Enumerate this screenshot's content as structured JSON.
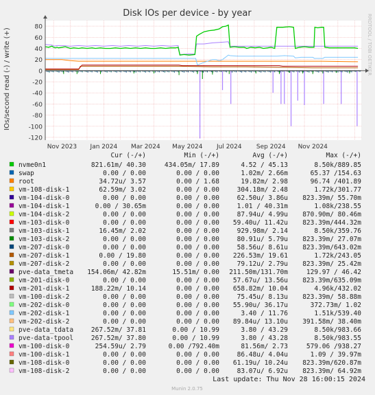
{
  "chart_data": {
    "type": "line",
    "title": "Disk IOs per device - by year",
    "ylabel": "IOs/second read (-) / write (+)",
    "watermark": "RRDTOOL / TOBI OETIKER",
    "ylim": [
      -125,
      90
    ],
    "y_ticks": [
      "80",
      "60",
      "40",
      "20",
      "0",
      "-20",
      "-40",
      "-60",
      "-80",
      "-100",
      "-120"
    ],
    "x_ticks": [
      "Nov 2023",
      "Jan 2024",
      "Mar 2024",
      "May 2024",
      "Jul 2024",
      "Sep 2024",
      "Nov 2024"
    ],
    "grid": true,
    "column_headers": [
      "Cur (-/+)",
      "Min (-/+)",
      "Avg (-/+)",
      "Max (-/+)"
    ],
    "series": [
      {
        "name": "nvme0n1",
        "color": "#00cc00",
        "cur": "821.61m/ 40.30",
        "min": "434.05m/ 17.89",
        "avg": "4.52 / 45.13",
        "max": "8.50k/889.85"
      },
      {
        "name": "swap",
        "color": "#0066b3",
        "cur": "0.00 / 0.00",
        "min": "0.00 / 0.00",
        "avg": "1.02m/ 2.66m",
        "max": "65.37 /154.63"
      },
      {
        "name": "root",
        "color": "#ff8000",
        "cur": "34.72u/ 3.57",
        "min": "0.00 / 1.68",
        "avg": "19.82m/ 2.98",
        "max": "96.74 /401.89"
      },
      {
        "name": "vm-108-disk-1",
        "color": "#ffcc00",
        "cur": "62.59m/ 3.02",
        "min": "0.00 / 0.00",
        "avg": "304.18m/ 2.48",
        "max": "1.72k/301.77"
      },
      {
        "name": "vm-104-disk-0",
        "color": "#330099",
        "cur": "0.00 / 0.00",
        "min": "0.00 / 0.00",
        "avg": "62.50u/ 3.86u",
        "max": "823.39m/ 55.70m"
      },
      {
        "name": "vm-104-disk-1",
        "color": "#990099",
        "cur": "0.00 / 30.65m",
        "min": "0.00 / 0.00",
        "avg": "1.01 / 40.31m",
        "max": "1.08k/238.55"
      },
      {
        "name": "vm-104-disk-2",
        "color": "#ccff00",
        "cur": "0.00 / 0.00",
        "min": "0.00 / 0.00",
        "avg": "87.94u/ 4.99u",
        "max": "870.90m/ 80.46m"
      },
      {
        "name": "vm-103-disk-0",
        "color": "#ff0000",
        "cur": "0.00 / 0.00",
        "min": "0.00 / 0.00",
        "avg": "59.40u/ 11.42u",
        "max": "823.39m/444.32m"
      },
      {
        "name": "vm-103-disk-1",
        "color": "#808080",
        "cur": "16.45m/ 2.02",
        "min": "0.00 / 0.00",
        "avg": "929.98m/ 2.14",
        "max": "8.50k/359.76"
      },
      {
        "name": "vm-103-disk-2",
        "color": "#008f00",
        "cur": "0.00 / 0.00",
        "min": "0.00 / 0.00",
        "avg": "80.91u/ 5.79u",
        "max": "823.39m/ 27.07m"
      },
      {
        "name": "vm-207-disk-0",
        "color": "#00487d",
        "cur": "0.00 / 0.00",
        "min": "0.00 / 0.00",
        "avg": "58.56u/ 8.61u",
        "max": "823.39m/643.02m"
      },
      {
        "name": "vm-207-disk-1",
        "color": "#b35a00",
        "cur": "0.00 / 19.80",
        "min": "0.00 / 0.00",
        "avg": "226.53m/ 19.61",
        "max": "1.72k/243.05"
      },
      {
        "name": "vm-207-disk-2",
        "color": "#b38f00",
        "cur": "0.00 / 0.00",
        "min": "0.00 / 0.00",
        "avg": "79.12u/ 2.79u",
        "max": "823.39m/ 25.42m"
      },
      {
        "name": "pve-data_tmeta",
        "color": "#6b006b",
        "cur": "154.06m/ 42.82m",
        "min": "15.51m/ 0.00",
        "avg": "211.50m/131.70m",
        "max": "129.97 / 46.42"
      },
      {
        "name": "vm-201-disk-0",
        "color": "#8fb300",
        "cur": "0.00 / 0.00",
        "min": "0.00 / 0.00",
        "avg": "57.67u/ 13.56u",
        "max": "823.39m/635.09m"
      },
      {
        "name": "vm-201-disk-1",
        "color": "#b30000",
        "cur": "188.22m/ 10.14",
        "min": "0.00 / 0.00",
        "avg": "658.82m/ 10.04",
        "max": "4.96k/432.02"
      },
      {
        "name": "vm-100-disk-2",
        "color": "#bebebe",
        "cur": "0.00 / 0.00",
        "min": "0.00 / 0.00",
        "avg": "75.45u/ 8.13u",
        "max": "823.39m/ 58.88m"
      },
      {
        "name": "vm-202-disk-0",
        "color": "#80ff80",
        "cur": "0.00 / 0.00",
        "min": "0.00 / 0.00",
        "avg": "55.90u/ 36.17u",
        "max": "372.73m/ 1.02"
      },
      {
        "name": "vm-202-disk-1",
        "color": "#80c9ff",
        "cur": "0.00 / 0.00",
        "min": "0.00 / 0.00",
        "avg": "3.40 / 11.76",
        "max": "1.51k/539.40"
      },
      {
        "name": "vm-202-disk-2",
        "color": "#ffc080",
        "cur": "0.00 / 0.00",
        "min": "0.00 / 0.00",
        "avg": "89.84u/ 13.10u",
        "max": "391.58m/ 38.40m"
      },
      {
        "name": "pve-data_tdata",
        "color": "#ffe680",
        "cur": "267.52m/ 37.81",
        "min": "0.00 / 10.99",
        "avg": "3.80 / 43.29",
        "max": "8.50k/983.66"
      },
      {
        "name": "pve-data-tpool",
        "color": "#aa80ff",
        "cur": "267.52m/ 37.80",
        "min": "0.00 / 10.99",
        "avg": "3.80 / 43.28",
        "max": "8.50k/983.55"
      },
      {
        "name": "vm-100-disk-0",
        "color": "#ee00cc",
        "cur": "254.59u/ 2.79",
        "min": "0.00 /792.40m",
        "avg": "81.56m/ 2.73",
        "max": "579.06 /938.27"
      },
      {
        "name": "vm-100-disk-1",
        "color": "#ff8080",
        "cur": "0.00 / 0.00",
        "min": "0.00 / 0.00",
        "avg": "86.48u/ 4.04u",
        "max": "1.09 / 39.97m"
      },
      {
        "name": "vm-108-disk-0",
        "color": "#666600",
        "cur": "0.00 / 0.00",
        "min": "0.00 / 0.00",
        "avg": "61.19u/ 10.24u",
        "max": "823.39m/620.87m"
      },
      {
        "name": "vm-108-disk-2",
        "color": "#ffbfff",
        "cur": "0.00 / 0.00",
        "min": "0.00 / 0.00",
        "avg": "83.07u/ 6.92u",
        "max": "823.39m/ 64.92m"
      }
    ],
    "lines": {
      "nvme_write": [
        [
          0,
          43
        ],
        [
          0.2,
          42
        ],
        [
          0.4,
          44
        ],
        [
          0.5,
          42
        ],
        [
          0.6,
          41
        ],
        [
          0.7,
          42
        ],
        [
          0.8,
          41
        ],
        [
          1.0,
          42
        ],
        [
          1.2,
          43
        ],
        [
          1.5,
          40
        ],
        [
          1.7,
          41
        ],
        [
          2.0,
          40
        ],
        [
          2.2,
          41
        ],
        [
          2.5,
          40
        ],
        [
          2.8,
          41
        ],
        [
          3.0,
          40
        ],
        [
          3.3,
          41
        ],
        [
          3.6,
          40
        ],
        [
          3.9,
          40
        ],
        [
          4.2,
          41
        ],
        [
          4.5,
          40
        ],
        [
          4.8,
          41
        ],
        [
          5.1,
          40
        ],
        [
          5.4,
          41
        ],
        [
          5.7,
          40
        ],
        [
          6.0,
          41
        ],
        [
          6.3,
          40
        ],
        [
          6.6,
          40
        ],
        [
          6.9,
          41
        ],
        [
          7.2,
          40
        ],
        [
          7.5,
          41
        ],
        [
          7.8,
          41
        ],
        [
          7.95,
          42
        ],
        [
          8.05,
          28
        ],
        [
          8.3,
          29
        ],
        [
          8.6,
          28
        ],
        [
          8.95,
          29
        ],
        [
          9.05,
          62
        ],
        [
          9.2,
          65
        ],
        [
          9.5,
          70
        ],
        [
          9.8,
          72
        ],
        [
          10.1,
          73
        ],
        [
          10.4,
          75
        ],
        [
          10.6,
          79
        ],
        [
          10.8,
          80
        ],
        [
          10.95,
          82
        ],
        [
          11.05,
          42
        ],
        [
          11.3,
          43
        ],
        [
          11.6,
          42
        ],
        [
          11.9,
          42
        ],
        [
          12.05,
          40
        ],
        [
          12.3,
          42
        ],
        [
          12.55,
          41
        ],
        [
          12.8,
          42
        ],
        [
          13.05,
          40
        ],
        [
          13.3,
          41
        ],
        [
          13.5,
          42
        ],
        [
          13.72,
          40
        ],
        [
          13.85,
          78
        ],
        [
          14.2,
          78
        ],
        [
          14.6,
          79
        ],
        [
          14.85,
          78
        ],
        [
          14.95,
          40
        ],
        [
          15.2,
          42
        ],
        [
          15.5,
          43
        ],
        [
          15.8,
          42
        ],
        [
          16.0,
          42
        ],
        [
          16.07,
          42
        ],
        [
          16.12,
          78
        ],
        [
          16.3,
          77
        ],
        [
          16.5,
          78
        ],
        [
          16.65,
          78
        ],
        [
          16.72,
          42
        ],
        [
          17.0,
          41
        ],
        [
          17.4,
          41
        ],
        [
          17.8,
          41
        ],
        [
          18.2,
          41
        ],
        [
          18.5,
          41
        ],
        [
          18.7,
          40
        ]
      ],
      "tpool_write": [
        [
          0,
          47
        ],
        [
          0.4,
          46
        ],
        [
          0.55,
          44
        ],
        [
          0.7,
          45
        ],
        [
          1.0,
          45
        ],
        [
          1.5,
          44
        ],
        [
          2.0,
          45
        ],
        [
          2.5,
          44
        ],
        [
          3.0,
          45
        ],
        [
          3.5,
          44
        ],
        [
          4.0,
          45
        ],
        [
          4.5,
          44
        ],
        [
          5.0,
          45
        ],
        [
          5.5,
          44
        ],
        [
          6.0,
          45
        ],
        [
          6.5,
          44
        ],
        [
          7.0,
          45
        ],
        [
          7.5,
          44
        ],
        [
          7.95,
          45
        ],
        [
          8.05,
          29
        ],
        [
          8.5,
          30
        ],
        [
          8.95,
          30
        ],
        [
          9.05,
          48
        ],
        [
          9.5,
          48
        ],
        [
          10.0,
          50
        ],
        [
          10.5,
          51
        ],
        [
          10.95,
          52
        ],
        [
          11.05,
          44
        ],
        [
          12.0,
          44
        ],
        [
          13.0,
          44
        ],
        [
          13.72,
          44
        ],
        [
          13.85,
          44
        ],
        [
          14.85,
          44
        ],
        [
          14.95,
          44
        ],
        [
          16.0,
          44
        ],
        [
          16.8,
          44
        ],
        [
          18.7,
          44
        ]
      ],
      "blue_write": [
        [
          0,
          22
        ],
        [
          7.95,
          22
        ],
        [
          8.05,
          22
        ],
        [
          9.0,
          22
        ],
        [
          9.1,
          10
        ],
        [
          9.5,
          15
        ],
        [
          9.8,
          18
        ],
        [
          10.0,
          20
        ],
        [
          10.2,
          20
        ],
        [
          10.4,
          18
        ],
        [
          10.6,
          20
        ],
        [
          10.95,
          28
        ],
        [
          11.05,
          27
        ],
        [
          11.5,
          26
        ],
        [
          12.0,
          26
        ],
        [
          13.72,
          26
        ],
        [
          13.85,
          26
        ],
        [
          14.3,
          27
        ],
        [
          14.85,
          26
        ],
        [
          14.95,
          23
        ],
        [
          15.3,
          24
        ],
        [
          15.8,
          24
        ],
        [
          16.0,
          24
        ],
        [
          16.1,
          22
        ],
        [
          16.6,
          22
        ],
        [
          16.72,
          24
        ],
        [
          17.2,
          24
        ],
        [
          18.0,
          24
        ],
        [
          18.7,
          24
        ]
      ],
      "root_write": [
        [
          0,
          20
        ],
        [
          1.0,
          20
        ],
        [
          1.5,
          18
        ],
        [
          2.0,
          17
        ],
        [
          4.0,
          17
        ],
        [
          7.0,
          17
        ],
        [
          9.0,
          17
        ],
        [
          11.0,
          17
        ],
        [
          13.0,
          17
        ],
        [
          15.0,
          17
        ],
        [
          16.5,
          17
        ],
        [
          18.7,
          16
        ]
      ],
      "vm201_write": [
        [
          0,
          3
        ],
        [
          2.0,
          3
        ],
        [
          2.2,
          10
        ],
        [
          4.0,
          10
        ],
        [
          6.0,
          10
        ],
        [
          8.0,
          10
        ],
        [
          8.2,
          9
        ],
        [
          10.0,
          9
        ],
        [
          12.0,
          9
        ],
        [
          14.0,
          9
        ],
        [
          14.2,
          8
        ],
        [
          16.0,
          8
        ],
        [
          18.0,
          8
        ],
        [
          18.7,
          8
        ]
      ],
      "vm207_write": [
        [
          0,
          2
        ],
        [
          2.0,
          2
        ],
        [
          2.1,
          8
        ],
        [
          4.0,
          8
        ],
        [
          8.0,
          8
        ],
        [
          10.0,
          7
        ],
        [
          12.0,
          7
        ],
        [
          14.0,
          6
        ],
        [
          16.0,
          5
        ],
        [
          18.7,
          5
        ]
      ],
      "read_spikes": [
        [
          1.1,
          -6
        ],
        [
          1.9,
          -6
        ],
        [
          3.3,
          -6
        ],
        [
          5.3,
          -5
        ],
        [
          6.5,
          -5
        ],
        [
          8.0,
          -8
        ],
        [
          9.1,
          -6
        ],
        [
          9.4,
          -15
        ],
        [
          10.0,
          -7
        ],
        [
          10.6,
          -9
        ],
        [
          11.0,
          -6
        ],
        [
          12.6,
          -5
        ],
        [
          14.0,
          -6
        ],
        [
          14.6,
          -4
        ],
        [
          15.4,
          -5
        ],
        [
          16.0,
          -6
        ],
        [
          16.6,
          -5
        ],
        [
          17.4,
          -4
        ],
        [
          18.2,
          -5
        ]
      ],
      "purple_spikes": [
        [
          9.25,
          -122
        ],
        [
          10.6,
          -35
        ],
        [
          11.1,
          -60
        ],
        [
          13.62,
          -40
        ],
        [
          14.1,
          -60
        ],
        [
          14.3,
          -60
        ],
        [
          14.7,
          -100
        ],
        [
          15.1,
          -54
        ],
        [
          15.5,
          -62
        ],
        [
          16.65,
          -60
        ],
        [
          17.7,
          -60
        ],
        [
          18.65,
          -100
        ]
      ]
    }
  },
  "footer": {
    "last_update": "Last update: Thu Nov 28 16:00:15 2024",
    "version": "Munin 2.0.75"
  }
}
